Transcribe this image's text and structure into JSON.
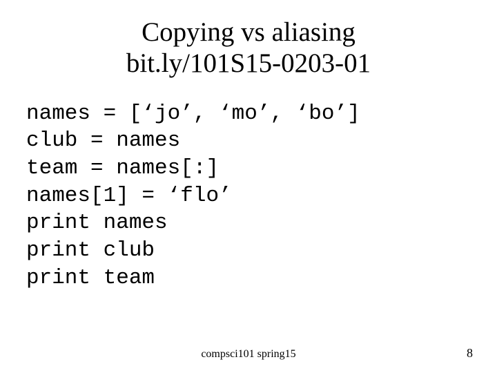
{
  "title": {
    "line1": "Copying vs aliasing",
    "line2": "bit.ly/101S15-0203-01"
  },
  "code": {
    "l1": "names = [‘jo’, ‘mo’, ‘bo’]",
    "l2": "club = names",
    "l3": "team = names[:]",
    "l4": "names[1] = ‘flo’",
    "l5": "print names",
    "l6": "print club",
    "l7": "print team"
  },
  "footer": {
    "course": "compsci101 spring15",
    "page": "8"
  }
}
